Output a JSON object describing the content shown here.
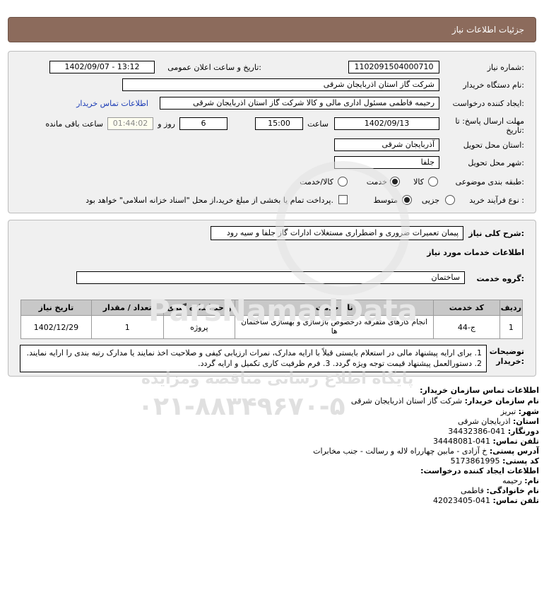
{
  "header": {
    "title": "جزئیات اطلاعات نیاز"
  },
  "form": {
    "need_number_label": "شماره نیاز:",
    "need_number": "1102091504000710",
    "announce_label": "تاریخ و ساعت اعلان عمومی:",
    "announce_value": "1402/09/07 - 13:12",
    "buyer_org_label": "نام دستگاه خریدار:",
    "buyer_org": "شرکت گاز استان اذربایجان شرقی",
    "creator_label": "ایجاد کننده درخواست:",
    "creator": "رحیمه فاطمی مسئول اداری مالی و کالا شرکت گاز استان اذربایجان شرقی",
    "contact_link": "اطلاعات تماس خریدار",
    "deadline_label_1": "مهلت ارسال پاسخ: تا",
    "deadline_label_2": "تاریخ:",
    "deadline_date": "1402/09/13",
    "time_label": "ساعت",
    "deadline_time": "15:00",
    "days": "6",
    "days_label": "روز و",
    "remaining": "01:44:02",
    "remaining_label": "ساعت باقی مانده",
    "delivery_place_label": "استان محل تحویل:",
    "delivery_place": "آذربایجان شرقی",
    "delivery_city_label": "شهر محل تحویل:",
    "delivery_city": "جلفا",
    "category_label": "طبقه بندی موضوعی:",
    "category_options": [
      "کالا",
      "خدمت",
      "کالا/خدمت"
    ],
    "category_selected": "خدمت",
    "process_label": "نوع فرآیند خرید :",
    "process_options": [
      "جزیی",
      "متوسط"
    ],
    "process_selected": "متوسط",
    "payment_note": "پرداخت تمام یا بخشی از مبلغ خرید،از محل \"اسناد خزانه اسلامی\" خواهد بود."
  },
  "description": {
    "label": "شرح کلی نیاز:",
    "value": "پیمان تعمیرات ضروری و اضطراری مستغلات ادارات گاز جلفا و سیه رود",
    "services_heading": "اطلاعات خدمات مورد نیاز",
    "group_label": "گروه خدمت:",
    "group_value": "ساختمان"
  },
  "table": {
    "headers": [
      "ردیف",
      "کد خدمت",
      "نام خدمت",
      "واحد اندازه گیری",
      "تعداد / مقدار",
      "تاریخ نیاز"
    ],
    "rows": [
      [
        "1",
        "ج-44",
        "انجام کارهای متفرقه درخصوص بازسازی و بهسازی ساختمان ها",
        "پروژه",
        "1",
        "1402/12/29"
      ]
    ]
  },
  "notes": {
    "label_1": "توضیحات",
    "label_2": "خریدار:",
    "text": "1. برای ارایه پیشنهاد مالی در استعلام بایستی قبلاً با ارایه مدارک، نمرات ارزیابی کیفی و صلاحیت اخذ نمایند یا مدارک رتبه بندی را ارایه نمایند. 2. دستورالعمل پیشنهاد قیمت توجه ویژه گردد. 3. فرم ظرفیت کاری تکمیل و ارایه گردد."
  },
  "contact": {
    "title": "اطلاعات تماس سازمان خریدار:",
    "org_label": "نام سازمان خریدار:",
    "org": "شرکت گاز استان اذربایجان شرقی",
    "city_label": "شهر:",
    "city": "تبریز",
    "province_label": "استان:",
    "province": "اذربایجان شرقی",
    "fax_label": "دورنگار:",
    "fax": "041-34432386",
    "phone_label": "تلفن تماس:",
    "phone": "041-34448081",
    "address_label": "آدرس پستی:",
    "address": "خ آزادی - مابین چهارراه لاله و رسالت - جنب مخابرات",
    "postal_label": "کد پستی:",
    "postal": "5173861995",
    "creator_title": "اطلاعات ایجاد کننده درخواست:",
    "first_name_label": "نام:",
    "first_name": "رحیمه",
    "last_name_label": "نام خانوادگی:",
    "last_name": "فاطمی",
    "creator_phone_label": "تلفن تماس:",
    "creator_phone": "041-42023405"
  },
  "watermark": {
    "brand": "ParsNamadData",
    "subtitle": "پایگاه اطلاع رسانی مناقصه ومزایده",
    "phone": "۰۲۱-۸۸۳۴۹۶۷۰-۵"
  },
  "colors": {
    "header": "#8c6b5c",
    "panel": "#f0f0f0",
    "link": "#1a3bb5"
  }
}
